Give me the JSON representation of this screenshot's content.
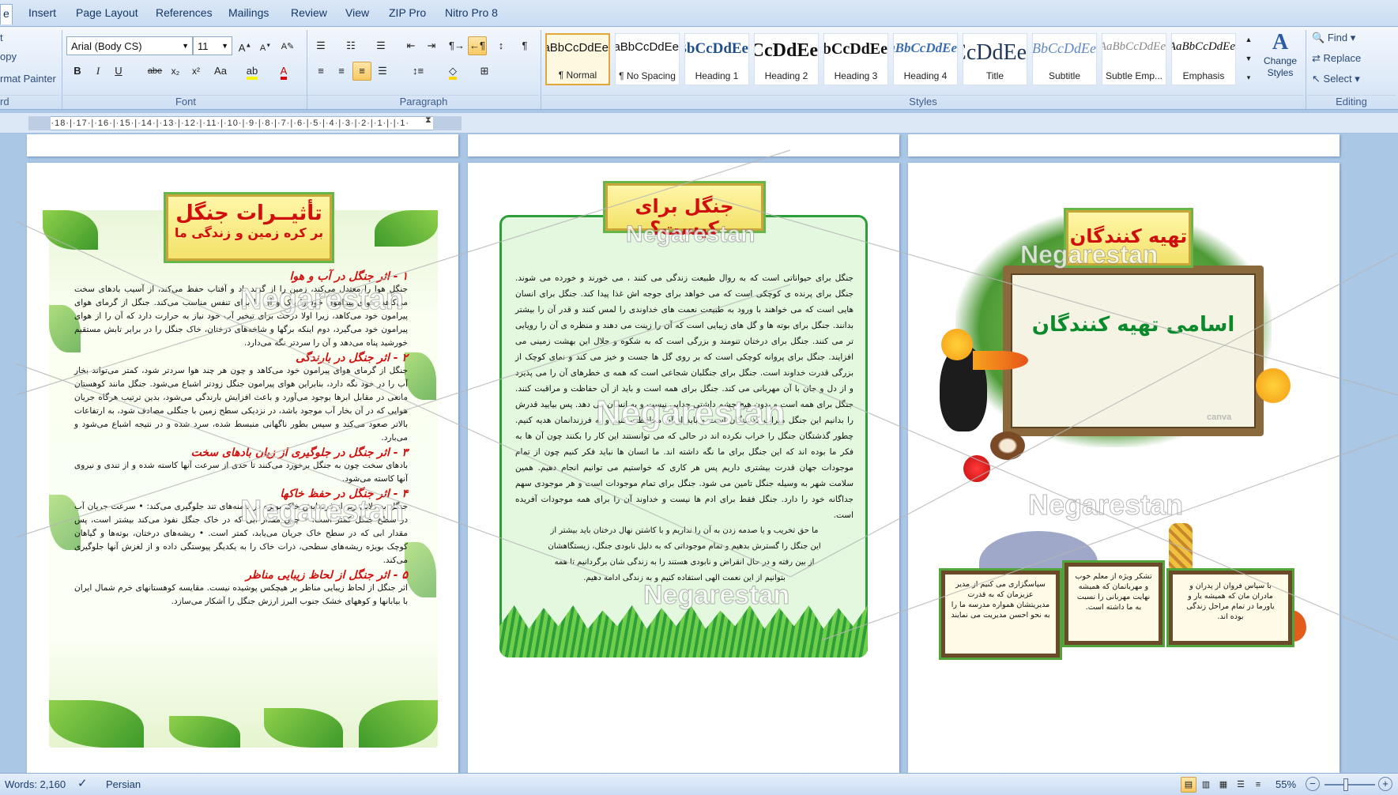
{
  "ribbon": {
    "tabs": [
      "e",
      "Insert",
      "Page Layout",
      "References",
      "Mailings",
      "Review",
      "View",
      "ZIP Pro",
      "Nitro Pro 8"
    ],
    "clipboard": {
      "items": [
        "t",
        "opy",
        "rmat Painter"
      ],
      "label": "rd"
    },
    "font": {
      "name": "Arial (Body CS)",
      "size": "11",
      "label": "Font",
      "buttons": [
        "B",
        "I",
        "U",
        "abe",
        "x₂",
        "x²",
        "Aa",
        "A",
        "A",
        "A",
        "A"
      ]
    },
    "paragraph": {
      "label": "Paragraph"
    },
    "styles": {
      "label": "Styles",
      "items": [
        {
          "preview": "AaBbCcDdEe",
          "name": "¶ Normal"
        },
        {
          "preview": "AaBbCcDdEe",
          "name": "¶ No Spacing"
        },
        {
          "preview": "AaBbCcDdEe",
          "name": "Heading 1"
        },
        {
          "preview": "AaBbCcDdEe",
          "name": "Heading 2"
        },
        {
          "preview": "AaBbCcDdEe",
          "name": "Heading 3"
        },
        {
          "preview": "AaBbCcDdEe",
          "name": "Heading 4"
        },
        {
          "preview": "AaBbCcDdEe",
          "name": "Title"
        },
        {
          "preview": "AaBbCcDdEe",
          "name": "Subtitle"
        },
        {
          "preview": "AaBbCcDdEe",
          "name": "Subtle Emp..."
        },
        {
          "preview": "AaBbCcDdEe",
          "name": "Emphasis"
        }
      ],
      "change_styles": "Change Styles"
    },
    "editing": {
      "label": "Editing",
      "find": "Find",
      "replace": "Replace",
      "select": "Select"
    }
  },
  "ruler": {
    "text": "·19·|·18·|·17·|·16·|·15·|·14·|·13·|·12·|·11·|·10·|·9·|·8·|·7·|·6·|·5·|·4·|·3·|·2·|·1·|·|·1·"
  },
  "watermark": "Negarestan",
  "page_left": {
    "title": "تأثیــرات جنگل",
    "subtitle": "بر کره زمین و زندگی ما",
    "h1": "۱ - اثر جنگل در آب و هوا",
    "p1": "جنگل هوا را معتدل می‌کند، زمین را از گزند باد و آفتاب حفظ می‌کند، از آسیب بادهای سخت می‌کاهد، هوای پیرامون خود را پاک و آن را برای تنفس مناسب می‌کند. جنگل از گرمای هوای پیرامون خود می‌کاهد، زیرا اولا درخت برای تبخیر آب خود نیاز به حرارت دارد که آن را از هوای پیرامون خود می‌گیرد، دوم اینکه برگها و شاخه‌های درختان، خاک جنگل را در برابر تابش مستقیم خورشید پناه می‌دهد و آن را سردتر نگه می‌دارد.",
    "h2": "۲ - اثر جنگل در بارندگی",
    "p2": "جنگل از گرمای هوای پیرامون خود می‌کاهد و چون هر چند هوا سردتر شود، کمتر می‌تواند بخار آب را در خود نگه دارد، بنابراین هوای پیرامون جنگل زودتر اشباع می‌شود. جنگل مانند کوهستان مانعی در مقابل ابرها بوجود می‌آورد و باعث افزایش بارندگی می‌شود، بدین ترتیب هرگاه جریان هوایی که در آن بخار آب موجود باشد، در نزدیکی سطح زمین با جنگلی مصادف شود، به ارتفاعات بالاتر صعود می‌کند و سپس بطور ناگهانی منبسط شده، سرد شده و در نتیجه اشباع می‌شود و می‌بارد.",
    "h3": "۳ - اثر جنگل در جلوگیری از زیان بادهای سخت",
    "p3": "بادهای سخت چون به جنگل برخورد می‌کنند تا حدی از سرعت آنها کاسته شده و از تندی و نیروی آنها کاسته می‌شود.",
    "h4": "۴ - اثر جنگل در حفظ خاکها",
    "p4": "جنگل به دلایل زیر از فرسایش خاک بویژه در دامنه‌های تند جلوگیری می‌کند: • سرعت جریان آب در سطح جنگل کمتر است. • چون مقدار ابی که در خاک جنگل نفوذ می‌کند بیشتر است، پس مقدار ابی که در سطح خاک جریان می‌یابد، کمتر است. • ریشه‌های درختان، بوته‌ها و گیاهان کوچک بویژه ریشه‌های سطحی، ذرات خاک را به یکدیگر پیوستگی داده و از لغزش آنها جلوگیری می‌کند.",
    "h5": "۵ - اثر جنگل از لحاظ زیبایی مناظر",
    "p5": "اثر جنگل از لحاظ زیبایی مناظر بر هیچکس پوشیده نیست. مقایسه کوهستانهای خرم شمال ایران با بیابانها و کوههای خشک جنوب البرز ارزش جنگل را آشکار می‌سازد."
  },
  "page_middle": {
    "title": "جنگل برای کیست؟",
    "p1": "جنگل برای حیواناتی است که به روال طبیعت زندگی می کنند ، می خورند و خورده می شوند. جنگل برای پرنده ی کوچکی است که می خواهد برای جوجه اش غذا پیدا کند. جنگل برای انسان هایی است که می خواهند با ورود به طبیعت نعمت های خداوندی را لمس کنند و قدر آن را بیشتر بدانند. جنگل برای بوته ها و گل های زیبایی است که آن را زینت می دهند و منظره ی آن را رویایی تر می کنند. جنگل برای درختان تنومند و بزرگی است که به شکوه و جلال این بهشت زمینی می افزایند. جنگل برای پروانه کوچکی است که بر روی گل ها جست و خیز می کند و نمای کوچک از بزرگی قدرت خداوند است. جنگل برای جنگلبان شجاعی است که همه ی خطرهای آن را می پذیرد و از دل و جان با آن مهربانی می کند. جنگل برای همه است و باید از آن حفاظت و مراقبت کنند. جنگل برای همه است و بدون هیچ چشم داشتی جدایی نیست و به انسان می دهد. پس بیایید قدرش را بدانیم این جنگل میراث گذشتگان است و باید از آن محافظت کنیم و به فرزندانمان هدیه کنیم. چطور گذشتگان جنگل را خراب نکرده اند در حالی که می توانستند این کار را بکنند چون آن ها به فکر ما بوده اند که این جنگل برای ما نگه داشته اند. ما انسان ها نباید فکر کنیم چون از تمام موجودات جهان قدرت بیشتری داریم پس هر کاری که خواستیم می توانیم انجام دهیم. همین سلامت شهر به وسیله جنگل تامین می شود. جنگل برای تمام موجودات است و هر موجودی سهم جداگانه خود را دارد. جنگل فقط برای ادم ها نیست و خداوند آن را برای همه موجودات آفریده است.",
    "p2": "ما حق تخریب و یا صدمه زدن به آن را نداریم و با کاشتن نهال درختان باید بیشتر از این جنگل را گسترش بدهیم و تمام موجوداتی که به دلیل نابودی جنگل، زیستگاهشان از بین رفته و در حال انقراض و نابودی هستند را به زندگی شان برگردانیم تا همه بتوانیم از این نعمت الهی استفاده کنیم و به زندگی ادامه دهیم."
  },
  "page_right": {
    "title": "تهیه کنندگان",
    "names_heading": "اسامی تهیه کنندگان",
    "card1": "سپاسگزاری می کنیم از مدیر عزیزمان که به قدرت مدیریتشان همواره مدرسه ما را به نحو احسن مدیریت می نمایند",
    "card2": "تشکر ویژه از معلم خوب و مهربانمان که همیشه نهایت مهربانی را نسبت به ما داشته است.",
    "card3": "با سپاس فروان از پدران و مادران مان که همیشه یار و یاورما در تمام مراحل زندگی بوده اند.",
    "stock_mark": "canva"
  },
  "status": {
    "words": "Words: 2,160",
    "language": "Persian",
    "zoom": "55%"
  },
  "colors": {
    "accent_red": "#d10e0e",
    "green_title": "#0a8a2a",
    "ribbon_bg": "#dde9f8",
    "workspace": "#abc7e6"
  }
}
